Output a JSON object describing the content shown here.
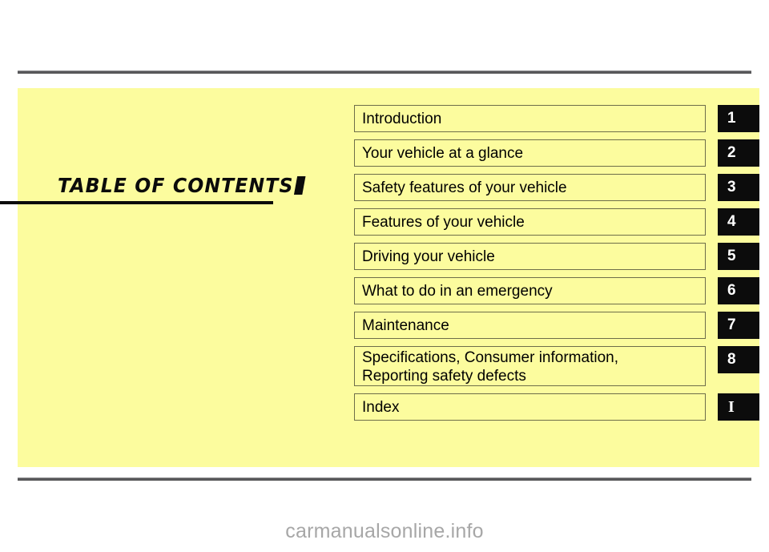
{
  "page": {
    "title": "TABLE  OF  CONTENTS",
    "panel_color": "#fcfc9e",
    "rule_color": "#58585a",
    "tab_color": "#0c0c0c",
    "watermark": "carmanualsonline.info"
  },
  "toc": {
    "entries": [
      {
        "label": "Introduction",
        "label_line2": "",
        "tab": "1",
        "tab_style": "sans"
      },
      {
        "label": "Your vehicle at a glance",
        "label_line2": "",
        "tab": "2",
        "tab_style": "sans"
      },
      {
        "label": "Safety features of your vehicle",
        "label_line2": "",
        "tab": "3",
        "tab_style": "sans"
      },
      {
        "label": "Features of your vehicle",
        "label_line2": "",
        "tab": "4",
        "tab_style": "sans"
      },
      {
        "label": "Driving your vehicle",
        "label_line2": "",
        "tab": "5",
        "tab_style": "sans"
      },
      {
        "label": "What to do in an emergency",
        "label_line2": "",
        "tab": "6",
        "tab_style": "sans"
      },
      {
        "label": "Maintenance",
        "label_line2": "",
        "tab": "7",
        "tab_style": "sans"
      },
      {
        "label": "Specifications, Consumer information,",
        "label_line2": "Reporting safety defects",
        "tab": "8",
        "tab_style": "sans"
      },
      {
        "label": "Index",
        "label_line2": "",
        "tab": "I",
        "tab_style": "serif"
      }
    ]
  }
}
